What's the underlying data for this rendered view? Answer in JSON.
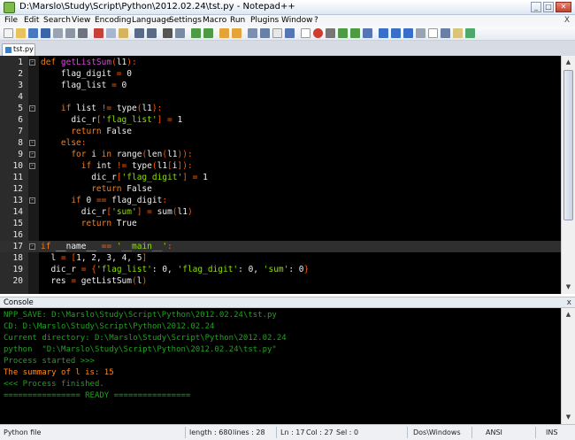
{
  "window": {
    "title": "D:\\Marslo\\Study\\Script\\Python\\2012.02.24\\tst.py - Notepad++",
    "controls": [
      "minimize",
      "maximize",
      "close"
    ]
  },
  "menu": {
    "items": [
      "File",
      "Edit",
      "Search",
      "View",
      "Encoding",
      "Language",
      "Settings",
      "Macro",
      "Run",
      "Plugins",
      "Window",
      "?"
    ],
    "close_glyph": "X"
  },
  "tab": {
    "label": "tst.py"
  },
  "editor": {
    "lines": [
      {
        "n": "1",
        "fold": "-",
        "tokens": [
          [
            "kw",
            "def "
          ],
          [
            "nm",
            "getListSum"
          ],
          [
            "op",
            "("
          ],
          [
            "",
            "l1"
          ],
          [
            "op",
            "):"
          ]
        ]
      },
      {
        "n": "2",
        "tokens": [
          [
            "",
            "    flag_digit "
          ],
          [
            "op",
            "="
          ],
          [
            "",
            " 0"
          ]
        ]
      },
      {
        "n": "3",
        "tokens": [
          [
            "",
            "    flag_list "
          ],
          [
            "op",
            "="
          ],
          [
            "",
            " 0"
          ]
        ]
      },
      {
        "n": "4",
        "tokens": [
          [
            "",
            ""
          ]
        ]
      },
      {
        "n": "5",
        "fold": "-",
        "tokens": [
          [
            "kw",
            "    if "
          ],
          [
            "",
            "list "
          ],
          [
            "op",
            "!="
          ],
          [
            "",
            " type"
          ],
          [
            "op",
            "("
          ],
          [
            "",
            "l1"
          ],
          [
            "op",
            "):"
          ]
        ]
      },
      {
        "n": "6",
        "tokens": [
          [
            "",
            "      dic_r"
          ],
          [
            "op",
            "["
          ],
          [
            "st",
            "'flag_list'"
          ],
          [
            "op",
            "]"
          ],
          [
            "",
            " "
          ],
          [
            "op",
            "="
          ],
          [
            "",
            " 1"
          ]
        ]
      },
      {
        "n": "7",
        "tokens": [
          [
            "kw",
            "      return "
          ],
          [
            "",
            "False"
          ]
        ]
      },
      {
        "n": "8",
        "fold": "-",
        "tokens": [
          [
            "kw",
            "    else"
          ],
          [
            "op",
            ":"
          ]
        ]
      },
      {
        "n": "9",
        "fold": "-",
        "tokens": [
          [
            "kw",
            "      for "
          ],
          [
            "",
            "i "
          ],
          [
            "kw",
            "in "
          ],
          [
            "",
            "range"
          ],
          [
            "op",
            "("
          ],
          [
            "",
            "len"
          ],
          [
            "op",
            "("
          ],
          [
            "",
            "l1"
          ],
          [
            "op",
            ")):"
          ]
        ]
      },
      {
        "n": "10",
        "fold": "-",
        "tokens": [
          [
            "kw",
            "        if "
          ],
          [
            "",
            "int "
          ],
          [
            "op",
            "!="
          ],
          [
            "",
            " type"
          ],
          [
            "op",
            "("
          ],
          [
            "",
            "l1"
          ],
          [
            "op",
            "["
          ],
          [
            "",
            "i"
          ],
          [
            "op",
            "]):"
          ]
        ]
      },
      {
        "n": "11",
        "tokens": [
          [
            "",
            "          dic_r"
          ],
          [
            "op",
            "["
          ],
          [
            "st",
            "'flag_digit'"
          ],
          [
            "op",
            "]"
          ],
          [
            "",
            " "
          ],
          [
            "op",
            "="
          ],
          [
            "",
            " 1"
          ]
        ]
      },
      {
        "n": "12",
        "tokens": [
          [
            "kw",
            "          return "
          ],
          [
            "",
            "False"
          ]
        ]
      },
      {
        "n": "13",
        "fold": "-",
        "tokens": [
          [
            "kw",
            "      if "
          ],
          [
            "",
            "0 "
          ],
          [
            "op",
            "=="
          ],
          [
            "",
            " flag_digit"
          ],
          [
            "op",
            ":"
          ]
        ]
      },
      {
        "n": "14",
        "tokens": [
          [
            "",
            "        dic_r"
          ],
          [
            "op",
            "["
          ],
          [
            "st",
            "'sum'"
          ],
          [
            "op",
            "]"
          ],
          [
            "",
            " "
          ],
          [
            "op",
            "="
          ],
          [
            "",
            " sum"
          ],
          [
            "op",
            "("
          ],
          [
            "",
            "l1"
          ],
          [
            "op",
            ")"
          ]
        ]
      },
      {
        "n": "15",
        "tokens": [
          [
            "kw",
            "        return "
          ],
          [
            "",
            "True"
          ]
        ]
      },
      {
        "n": "16",
        "tokens": [
          [
            "",
            ""
          ]
        ]
      },
      {
        "n": "17",
        "fold": "-",
        "highlight": true,
        "tokens": [
          [
            "kw",
            "if "
          ],
          [
            "",
            "__name__ "
          ],
          [
            "op",
            "=="
          ],
          [
            "",
            " "
          ],
          [
            "st",
            "'__main__'"
          ],
          [
            "op",
            ":"
          ]
        ]
      },
      {
        "n": "18",
        "tokens": [
          [
            "",
            "  l "
          ],
          [
            "op",
            "="
          ],
          [
            "",
            " "
          ],
          [
            "op",
            "["
          ],
          [
            "",
            "1, 2, 3, 4, 5"
          ],
          [
            "op",
            "]"
          ]
        ]
      },
      {
        "n": "19",
        "tokens": [
          [
            "",
            "  dic_r "
          ],
          [
            "op",
            "="
          ],
          [
            "",
            " "
          ],
          [
            "op",
            "{"
          ],
          [
            "st",
            "'flag_list'"
          ],
          [
            "",
            ": 0, "
          ],
          [
            "st",
            "'flag_digit'"
          ],
          [
            "",
            ": 0, "
          ],
          [
            "st",
            "'sum'"
          ],
          [
            "",
            ": 0"
          ],
          [
            "op",
            "}"
          ]
        ]
      },
      {
        "n": "20",
        "tokens": [
          [
            "",
            "  res "
          ],
          [
            "op",
            "="
          ],
          [
            "",
            " getListSum"
          ],
          [
            "op",
            "("
          ],
          [
            "",
            "l"
          ],
          [
            "op",
            ")"
          ]
        ]
      }
    ]
  },
  "console": {
    "title": "Console",
    "close_glyph": "x",
    "lines": [
      {
        "text": "NPP_SAVE: D:\\Marslo\\Study\\Script\\Python\\2012.02.24\\tst.py",
        "color": "#1fa21f"
      },
      {
        "text": "CD: D:\\Marslo\\Study\\Script\\Python\\2012.02.24",
        "color": "#1fa21f"
      },
      {
        "text": "Current directory: D:\\Marslo\\Study\\Script\\Python\\2012.02.24",
        "color": "#1fa21f"
      },
      {
        "text": "python  \"D:\\Marslo\\Study\\Script\\Python\\2012.02.24\\tst.py\"",
        "color": "#1fa21f"
      },
      {
        "text": "Process started >>>",
        "color": "#1fa21f"
      },
      {
        "text": "The summary of l is: 15",
        "color": "#ff8c1a"
      },
      {
        "text": "<<< Process finished.",
        "color": "#1fa21f"
      },
      {
        "text": "================ READY ================",
        "color": "#1fa21f"
      }
    ]
  },
  "status": {
    "filetype": "Python file",
    "length": "length : 680",
    "lines": "lines : 28",
    "ln": "Ln : 17",
    "col": "Col : 27",
    "sel": "Sel : 0",
    "eol": "Dos\\Windows",
    "encoding": "ANSI",
    "mode": "INS"
  }
}
